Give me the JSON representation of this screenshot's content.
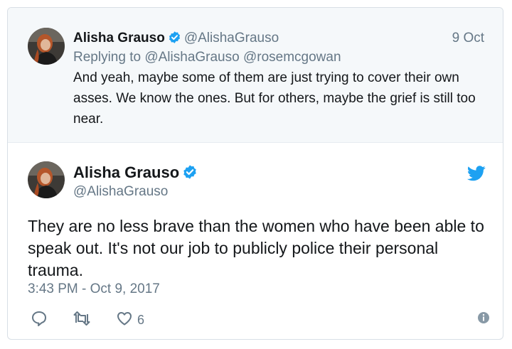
{
  "parent_tweet": {
    "author_name": "Alisha Grauso",
    "author_handle": "@AlishaGrauso",
    "date": "9 Oct",
    "replying_prefix": "Replying to",
    "replying_to": [
      "@AlishaGrauso",
      "@rosemcgowan"
    ],
    "text": "And yeah, maybe some of them are just trying to cover their own asses. We know the ones. But for others, maybe the grief is still too near."
  },
  "main_tweet": {
    "author_name": "Alisha Grauso",
    "author_handle": "@AlishaGrauso",
    "text": "They are no less brave than the women who have been able to speak out. It's not our job to publicly police their personal trauma.",
    "timestamp": "3:43 PM - Oct 9, 2017",
    "like_count": "6"
  },
  "icons": {
    "verified": "verified-badge-icon",
    "brand": "twitter-bird-icon",
    "reply": "reply-icon",
    "retweet": "retweet-icon",
    "like": "heart-icon",
    "info": "info-icon"
  },
  "colors": {
    "accent": "#1da1f2",
    "muted": "#657786",
    "text": "#14171a",
    "parent_bg": "#f5f8fa"
  }
}
